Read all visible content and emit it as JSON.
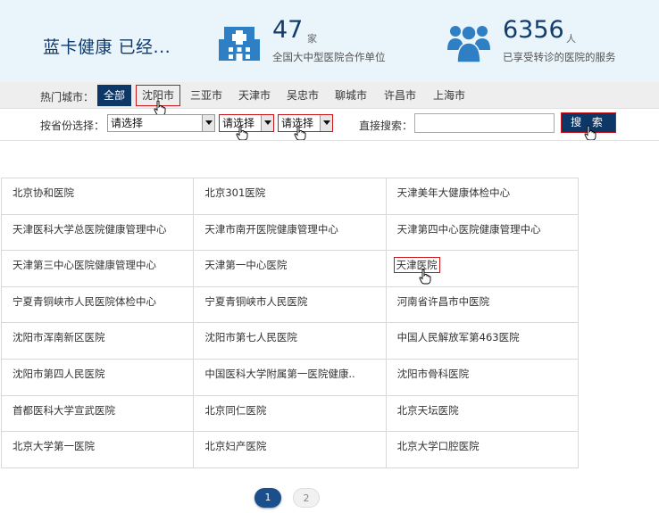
{
  "header": {
    "brand": "蓝卡健康 已经...",
    "stats": [
      {
        "number": "47",
        "unit": "家",
        "desc": "全国大中型医院合作单位",
        "icon": "hospital-icon"
      },
      {
        "number": "6356",
        "unit": "人",
        "desc": "已享受转诊的医院的服务",
        "icon": "people-group-icon"
      }
    ]
  },
  "hot_cities": {
    "label": "热门城市：",
    "items": [
      "全部",
      "沈阳市",
      "三亚市",
      "天津市",
      "吴忠市",
      "聊城市",
      "许昌市",
      "上海市"
    ],
    "active": "全部",
    "highlighted": "沈阳市"
  },
  "filter": {
    "province_label": "按省份选择：",
    "province_value": "请选择",
    "city_value": "请选择",
    "district_value": "请选择",
    "direct_label": "直接搜索：",
    "search_value": "",
    "search_button": "搜 索"
  },
  "hospitals": [
    [
      "北京协和医院",
      "北京301医院",
      "天津美年大健康体检中心"
    ],
    [
      "天津医科大学总医院健康管理中心",
      "天津市南开医院健康管理中心",
      "天津第四中心医院健康管理中心"
    ],
    [
      "天津第三中心医院健康管理中心",
      "天津第一中心医院",
      "天津医院"
    ],
    [
      "宁夏青铜峡市人民医院体检中心",
      "宁夏青铜峡市人民医院",
      "河南省许昌市中医院"
    ],
    [
      "沈阳市浑南新区医院",
      "沈阳市第七人民医院",
      "中国人民解放军第463医院"
    ],
    [
      "沈阳市第四人民医院",
      "中国医科大学附属第一医院健康..",
      "沈阳市骨科医院"
    ],
    [
      "首都医科大学宣武医院",
      "北京同仁医院",
      "北京天坛医院"
    ],
    [
      "北京大学第一医院",
      "北京妇产医院",
      "北京大学口腔医院"
    ]
  ],
  "pagination": {
    "current": "1",
    "next": "2"
  },
  "colors": {
    "brand_navy": "#0c3767",
    "highlight_red": "#c8161d",
    "banner_bg": "#e9f4fb",
    "icon_blue": "#2e7fc4"
  }
}
